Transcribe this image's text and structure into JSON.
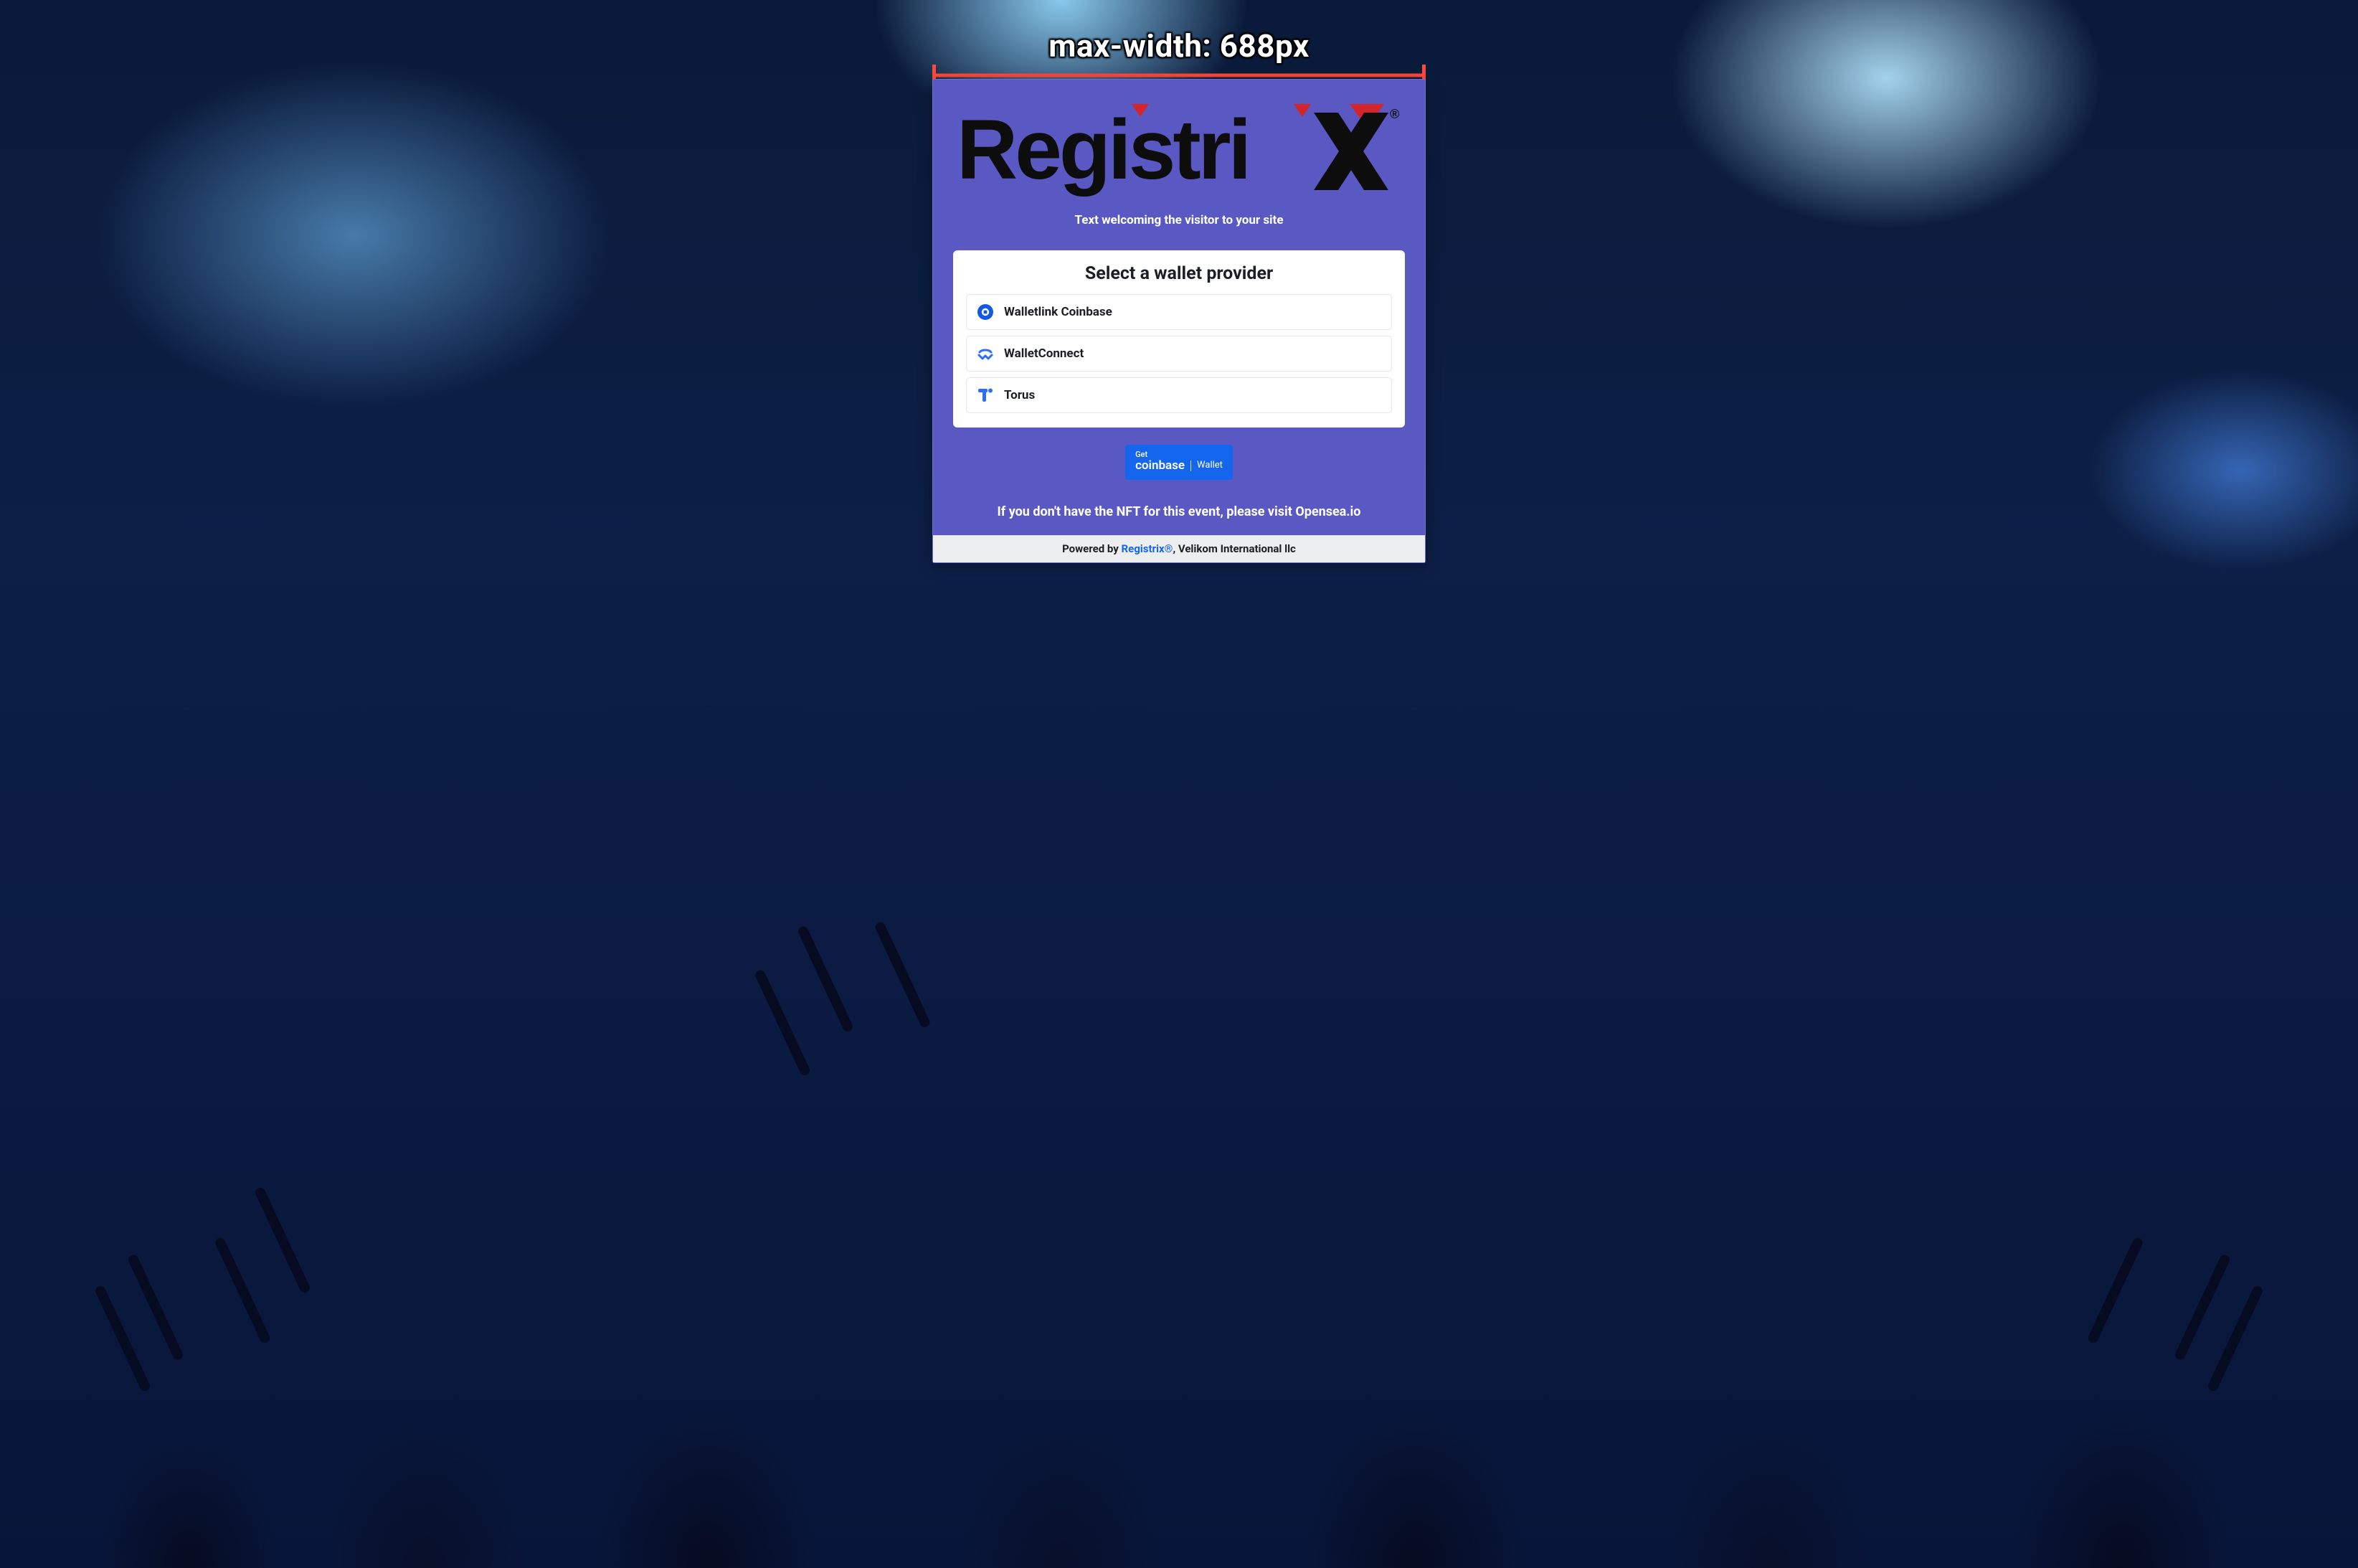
{
  "annotation": {
    "label": "max-width: 688px"
  },
  "logo": {
    "text": "Registrix",
    "trademark": "®"
  },
  "welcome": "Text welcoming the visitor to your site",
  "panel": {
    "title": "Select a wallet provider",
    "providers": [
      {
        "name": "Walletlink Coinbase",
        "icon": "coinbase"
      },
      {
        "name": "WalletConnect",
        "icon": "walletconnect"
      },
      {
        "name": "Torus",
        "icon": "torus"
      }
    ]
  },
  "coinbase_button": {
    "line1": "Get",
    "brand": "coinbase",
    "suffix": "Wallet"
  },
  "nft_note": "If you don't have the NFT for this event, please visit Opensea.io",
  "footer": {
    "prefix": "Powered by ",
    "brand": "Registrix®",
    "suffix": ", Velikom International llc"
  }
}
